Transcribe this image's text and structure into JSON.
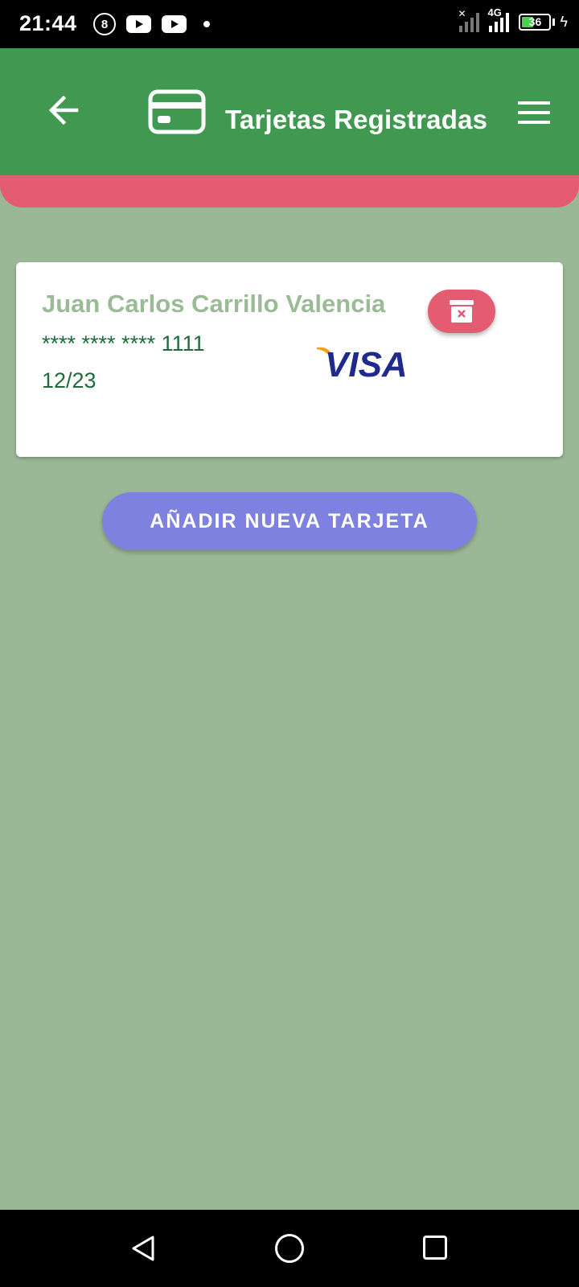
{
  "status_bar": {
    "time": "21:44",
    "notification_badge": "8",
    "network_type": "4G",
    "battery_level": "36",
    "icons": [
      "circle-8-icon",
      "youtube-icon",
      "youtube-icon",
      "dot-icon",
      "signal-no-service-icon",
      "signal-4g-icon",
      "battery-icon",
      "charging-bolt-icon"
    ]
  },
  "app_bar": {
    "title": "Tarjetas Registradas",
    "back_icon": "arrow-left-icon",
    "logo_icon": "credit-card-icon",
    "menu_icon": "hamburger-menu-icon",
    "background_color": "#419850",
    "accent_strip_color": "#e45c72"
  },
  "cards": [
    {
      "holder_name": "Juan Carlos Carrillo Valencia",
      "masked_number": "**** **** **** 1111",
      "expiry": "12/23",
      "brand": "VISA",
      "delete_icon": "delete-archive-icon"
    }
  ],
  "actions": {
    "add_card_label": "AÑADIR NUEVA TARJETA",
    "add_card_color": "#7f81e0"
  },
  "nav_bar": {
    "icons": [
      "nav-back-icon",
      "nav-home-icon",
      "nav-recents-icon"
    ]
  },
  "colors": {
    "page_background": "#9bb896",
    "name_text": "#9bbb96",
    "card_text": "#1f6b3a"
  }
}
